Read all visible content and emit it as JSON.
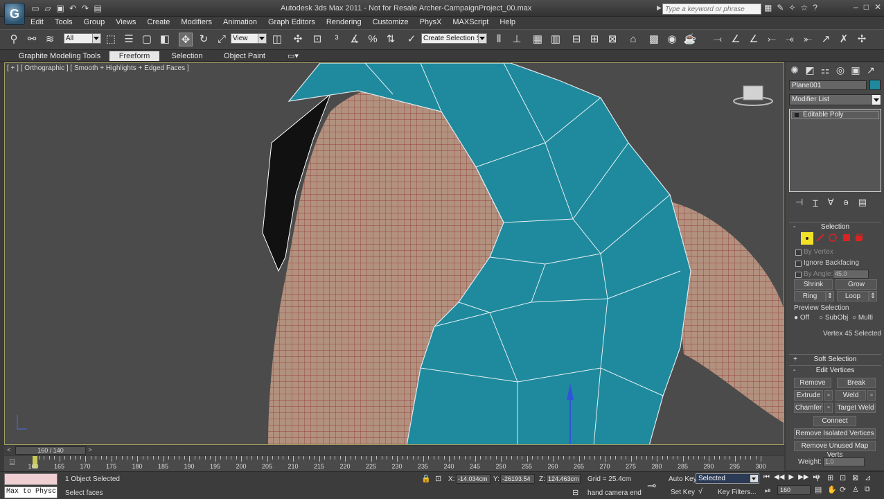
{
  "titlebar": {
    "title": "Autodesk 3ds Max 2011  -  Not for Resale   Archer-CampaignProject_00.max",
    "search_placeholder": "Type a keyword or phrase",
    "logo_letter": "G"
  },
  "menus": [
    "Edit",
    "Tools",
    "Group",
    "Views",
    "Create",
    "Modifiers",
    "Animation",
    "Graph Editors",
    "Rendering",
    "Customize",
    "PhysX",
    "MAXScript",
    "Help"
  ],
  "toolbar": {
    "selection_filter": "All",
    "reference_coord": "View",
    "named_selection": "Create Selection Se"
  },
  "ribbon": {
    "tabs": [
      "Graphite Modeling Tools",
      "Freeform",
      "Selection",
      "Object Paint"
    ],
    "active_tab": "Freeform"
  },
  "viewport": {
    "label": "[ + ] [ Orthographic ] [ Smooth + Highlights + Edged Faces ]",
    "mesh_color": "#1f8a9e",
    "skin_color": "#b08a78"
  },
  "command_panel": {
    "object_name": "Plane001",
    "object_color": "#1f8a9e",
    "modifier_list": "Modifier List",
    "stack_item": "Editable Poly",
    "selection_title": "Selection",
    "by_vertex": "By Vertex",
    "ignore_backfacing": "Ignore Backfacing",
    "by_angle": "By Angle:",
    "by_angle_value": "45.0",
    "shrink": "Shrink",
    "grow": "Grow",
    "ring": "Ring",
    "loop": "Loop",
    "preview_selection": "Preview Selection",
    "preview_off": "Off",
    "preview_subobj": "SubObj",
    "preview_multi": "Multi",
    "selection_status": "Vertex 45 Selected",
    "soft_selection": "Soft Selection",
    "edit_vertices": "Edit Vertices",
    "remove": "Remove",
    "break": "Break",
    "extrude": "Extrude",
    "weld": "Weld",
    "chamfer": "Chamfer",
    "target_weld": "Target Weld",
    "connect": "Connect",
    "remove_isolated": "Remove Isolated Vertices",
    "remove_unused": "Remove Unused Map Verts",
    "weight_label": "Weight:",
    "weight_value": "1.0"
  },
  "timeline": {
    "frame_display": "160 / 140",
    "current_frame": 160,
    "ticks": [
      160,
      165,
      170,
      175,
      180,
      185,
      190,
      195,
      200,
      205,
      210,
      215,
      220,
      225,
      230,
      235,
      240,
      245,
      250,
      255,
      260,
      265,
      270,
      275,
      280,
      285,
      290,
      295,
      300
    ]
  },
  "statusbar": {
    "maxscript": "Max to Physc",
    "status_main": "1 Object Selected",
    "status_prompt": "Select faces",
    "x_label": "X:",
    "x_value": "-14.034cm",
    "y_label": "Y:",
    "y_value": "-26193.54",
    "z_label": "Z:",
    "z_value": "124.463cm",
    "grid": "Grid = 25.4cm",
    "auto_key": "Auto Key",
    "key_mode": "Selected",
    "set_key": "Set Key",
    "key_filters": "Key Filters...",
    "frame": "160",
    "time_tag": "hand camera end"
  }
}
